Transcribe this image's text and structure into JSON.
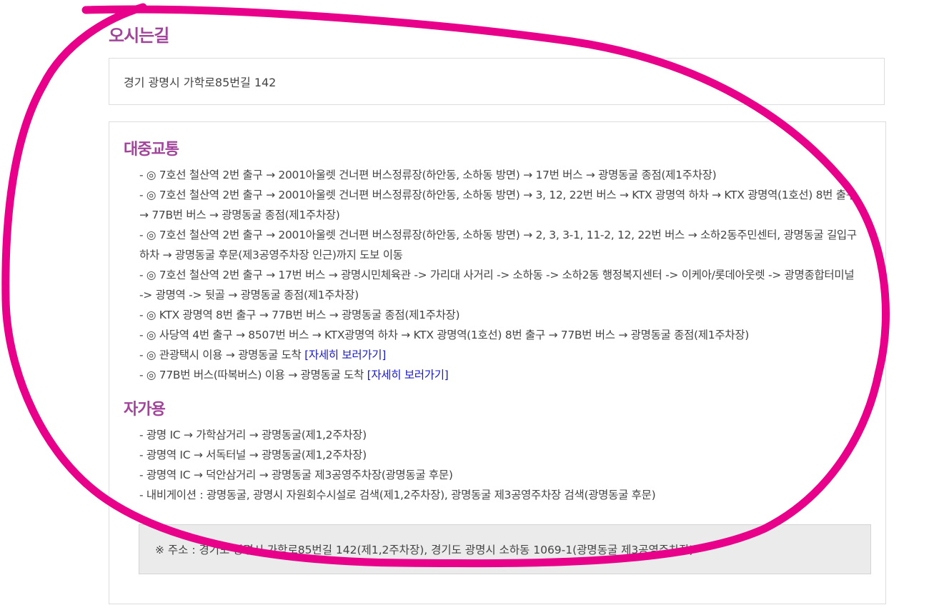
{
  "section_title": "오시는길",
  "address": "경기 광명시 가학로85번길 142",
  "public_transport": {
    "title": "대중교통",
    "routes": [
      {
        "text": "- ◎ 7호선 철산역 2번 출구 → 2001아울렛 건너편 버스정류장(하안동, 소하동 방면) → 17번 버스 → 광명동굴 종점(제1주차장)",
        "link": ""
      },
      {
        "text": "- ◎ 7호선 철산역 2번 출구 → 2001아울렛 건너편 버스정류장(하안동, 소하동 방면) → 3, 12, 22번 버스 → KTX 광명역 하차 → KTX 광명역(1호선) 8번 출구 → 77B번 버스 → 광명동굴 종점(제1주차장)",
        "link": ""
      },
      {
        "text": "- ◎ 7호선 철산역 2번 출구 → 2001아울렛 건너편 버스정류장(하안동, 소하동 방면) → 2, 3, 3-1, 11-2, 12, 22번 버스 → 소하2동주민센터, 광명동굴 길입구 하차 → 광명동굴 후문(제3공영주차장 인근)까지 도보 이동",
        "link": ""
      },
      {
        "text": "- ◎ 7호선 철산역 2번 출구 → 17번 버스 → 광명시민체육관 -> 가리대 사거리 -> 소하동 -> 소하2동 행정복지센터 -> 이케아/롯데아웃렛 -> 광명종합터미널 -> 광명역 -> 뒷골 → 광명동굴 종점(제1주차장)",
        "link": ""
      },
      {
        "text": "- ◎ KTX 광명역 8번 출구 → 77B번 버스 → 광명동굴 종점(제1주차장)",
        "link": ""
      },
      {
        "text": "- ◎ 사당역 4번 출구 → 8507번 버스 → KTX광명역 하차 → KTX 광명역(1호선) 8번 출구 → 77B번 버스 → 광명동굴 종점(제1주차장)",
        "link": ""
      },
      {
        "text": "- ◎ 관광택시 이용 → 광명동굴 도착 ",
        "link": "[자세히 보러가기]"
      },
      {
        "text": "- ◎ 77B번 버스(따복버스) 이용 → 광명동굴 도착 ",
        "link": "[자세히 보러가기]"
      }
    ]
  },
  "private_car": {
    "title": "자가용",
    "routes": [
      "- 광명 IC → 가학삼거리 → 광명동굴(제1,2주차장)",
      "- 광명역 IC → 서독터널 → 광명동굴(제1,2주차장)",
      "- 광명역 IC → 덕안삼거리 → 광명동굴 제3공영주차장(광명동굴 후문)",
      "- 내비게이션 : 광명동굴, 광명시 자원회수시설로 검색(제1,2주차장), 광명동굴 제3공영주차장 검색(광명동굴 후문)"
    ]
  },
  "notice": "※ 주소 : 경기도 광명시 가학로85번길 142(제1,2주차장), 경기도 광명시 소하동 1069-1(광명동굴 제3공영주차장)",
  "colors": {
    "heading": "#a0459a",
    "link": "#1919c8",
    "annotation": "#e8008a"
  }
}
